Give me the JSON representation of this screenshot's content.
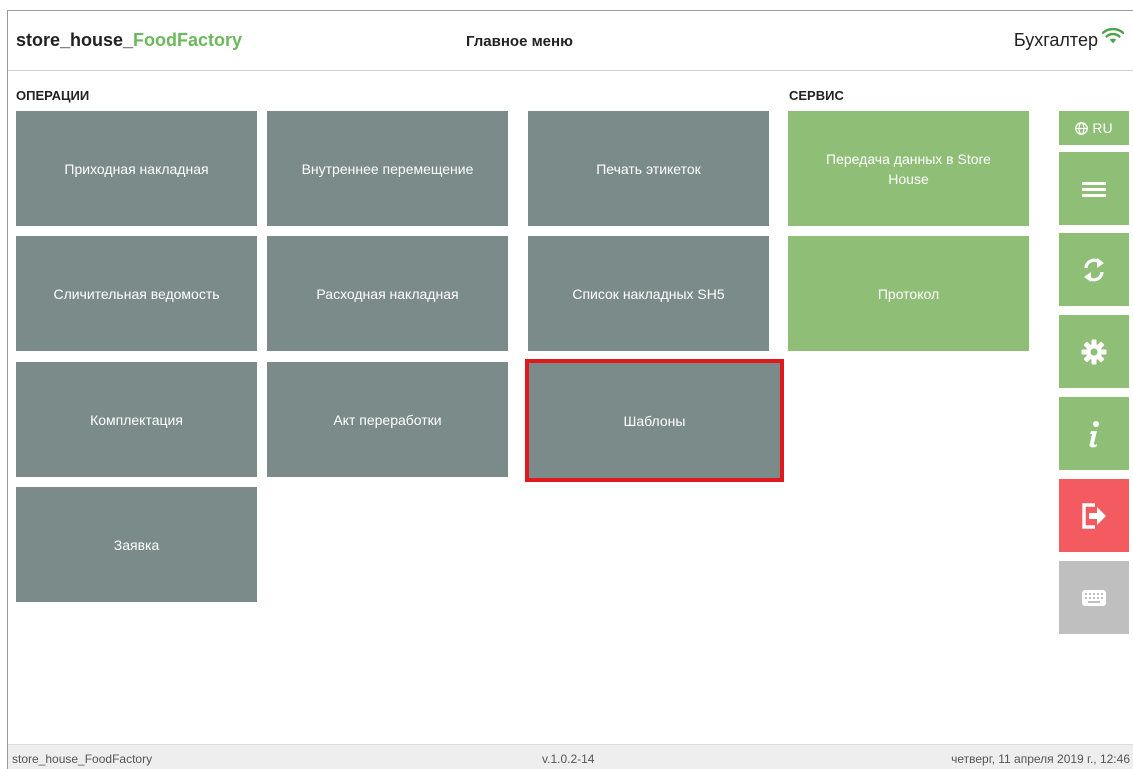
{
  "header": {
    "brand_main": "store_house_",
    "brand_accent": "FoodFactory",
    "title": "Главное меню",
    "user": "Бухгалтер",
    "wifi_icon": "wifi-icon"
  },
  "sections": {
    "operations": "ОПЕРАЦИИ",
    "service": "СЕРВИС"
  },
  "tiles": {
    "incoming_invoice": "Приходная накладная",
    "internal_transfer": "Внутреннее перемещение",
    "print_labels": "Печать этикеток",
    "matching_statement": "Сличительная ведомость",
    "outgoing_invoice": "Расходная накладная",
    "sh5_invoice_list": "Список накладных SH5",
    "assembly": "Комплектация",
    "processing_act": "Акт переработки",
    "templates": "Шаблоны",
    "request": "Заявка",
    "transfer_data": "Передача данных в Store House",
    "protocol": "Протокол"
  },
  "sidebar": {
    "language": "RU",
    "icons": [
      "globe-icon",
      "menu-icon",
      "sync-icon",
      "gear-icon",
      "info-icon",
      "logout-icon",
      "keyboard-icon"
    ]
  },
  "footer": {
    "app": "store_house_FoodFactory",
    "version": "v.1.0.2-14",
    "datetime": "четверг, 11 апреля 2019 г., 12:46"
  },
  "colors": {
    "tile_gray": "#7b8b89",
    "tile_green": "#8fbf77",
    "logout_red": "#f45b61",
    "keyboard_gray": "#bfbfbf",
    "selection_red": "#e0191e",
    "brand_green": "#6cb85c"
  },
  "state": {
    "selected_tile": "Шаблоны"
  }
}
